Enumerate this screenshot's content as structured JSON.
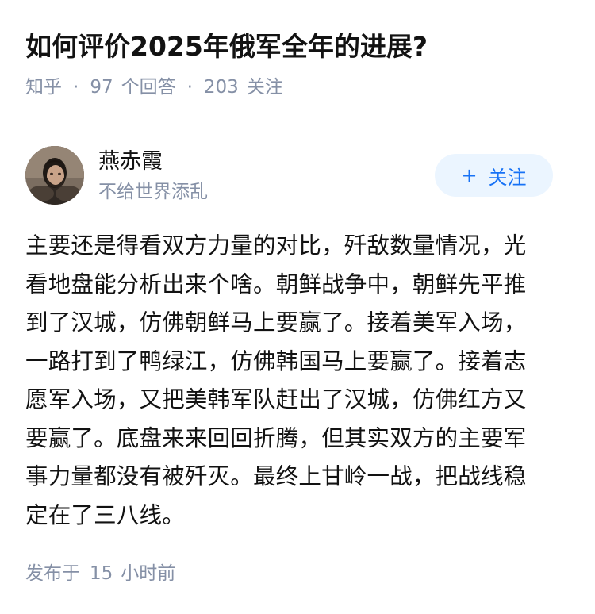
{
  "question": {
    "title": "如何评价2025年俄军全年的进展?",
    "source": "知乎",
    "separator": "·",
    "answers_count": "97",
    "answers_label": "个回答",
    "followers_count": "203",
    "followers_label": "关注"
  },
  "author": {
    "name": "燕赤霞",
    "bio": "不给世界添乱",
    "avatar_icon": "avatar-portrait-icon"
  },
  "follow_button": {
    "icon": "+",
    "label": "关注",
    "bg_color": "#ebf5ff",
    "text_color": "#1772f6"
  },
  "answer": {
    "lines": [
      "主要还是得看双方力量的对比，歼敌数量情况，光",
      "看地盘能分析出来个啥。朝鲜战争中，朝鲜先平推",
      "到了汉城，仿佛朝鲜马上要赢了。接着美军入场，",
      "一路打到了鸭绿江，仿佛韩国马上要赢了。接着志",
      "愿军入场，又把美韩军队赶出了汉城，仿佛红方又",
      "要赢了。底盘来来回回折腾，但其实双方的主要军",
      "事力量都没有被歼灭。最终上甘岭一战，把战线稳",
      "定在了三八线。"
    ]
  },
  "publish": {
    "prefix": "发布于",
    "amount": "15",
    "unit": "小时前"
  }
}
